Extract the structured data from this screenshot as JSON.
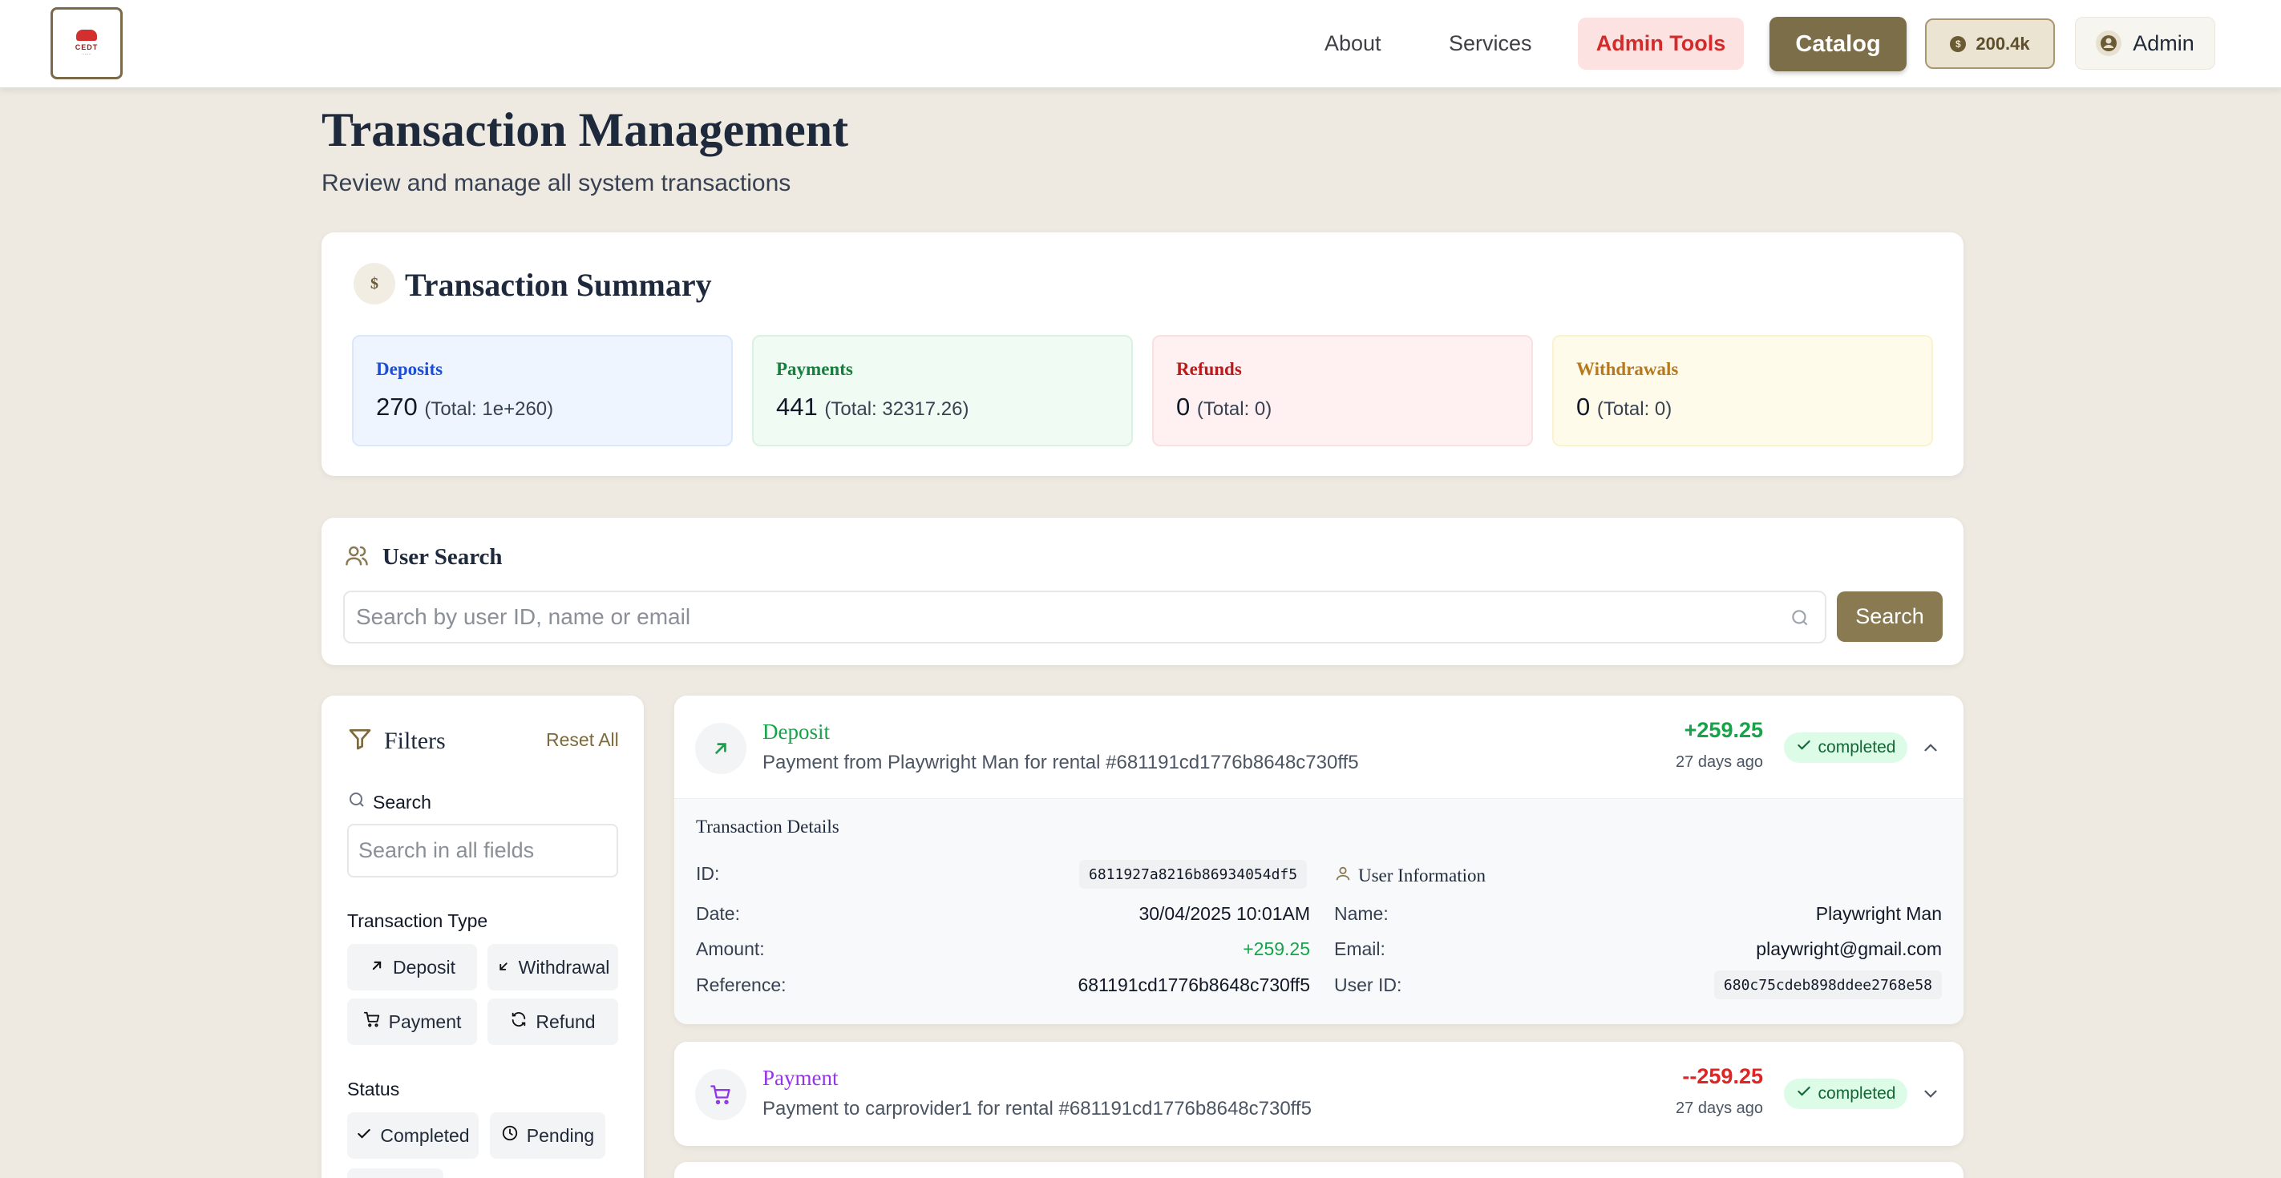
{
  "nav": {
    "logo_text": "CEDT",
    "about": "About",
    "services": "Services",
    "admin_tools": "Admin Tools",
    "catalog": "Catalog",
    "balance": "200.4k",
    "admin": "Admin"
  },
  "header": {
    "title": "Transaction Management",
    "subtitle": "Review and manage all system transactions"
  },
  "summary": {
    "icon": "$",
    "title": "Transaction Summary",
    "stats": [
      {
        "label": "Deposits",
        "count": "270",
        "total": "(Total: 1e+260)",
        "color": "#1d4ed8",
        "bg": "#eef5ff",
        "border": "#dbe7fb"
      },
      {
        "label": "Payments",
        "count": "441",
        "total": "(Total: 32317.26)",
        "color": "#15803d",
        "bg": "#effbf3",
        "border": "#d8f3e1"
      },
      {
        "label": "Refunds",
        "count": "0",
        "total": "(Total: 0)",
        "color": "#b91c1c",
        "bg": "#fff1f1",
        "border": "#fbe0e0"
      },
      {
        "label": "Withdrawals",
        "count": "0",
        "total": "(Total: 0)",
        "color": "#b7791f",
        "bg": "#fffbeb",
        "border": "#fbf2cf"
      }
    ]
  },
  "user_search": {
    "title": "User Search",
    "placeholder": "Search by user ID, name or email",
    "button": "Search"
  },
  "filters": {
    "title": "Filters",
    "reset": "Reset All",
    "search_label": "Search",
    "search_placeholder": "Search in all fields",
    "type_label": "Transaction Type",
    "types": [
      "Deposit",
      "Withdrawal",
      "Payment",
      "Refund"
    ],
    "status_label": "Status",
    "statuses": [
      "Completed",
      "Pending"
    ]
  },
  "transactions": [
    {
      "type": "Deposit",
      "type_color": "#16a34a",
      "description": "Payment from Playwright Man for rental #681191cd1776b8648c730ff5",
      "amount": "+259.25",
      "amount_color": "#16a34a",
      "ago": "27 days ago",
      "status": "completed",
      "details": {
        "title": "Transaction Details",
        "id_label": "ID:",
        "id": "6811927a8216b86934054df5",
        "date_label": "Date:",
        "date": "30/04/2025 10:01AM",
        "amount_label": "Amount:",
        "amount": "+259.25",
        "reference_label": "Reference:",
        "reference": "681191cd1776b8648c730ff5",
        "user_title": "User Information",
        "name_label": "Name:",
        "name": "Playwright Man",
        "email_label": "Email:",
        "email": "playwright@gmail.com",
        "user_id_label": "User ID:",
        "user_id": "680c75cdeb898ddee2768e58"
      }
    },
    {
      "type": "Payment",
      "type_color": "#9333ea",
      "description": "Payment to carprovider1 for rental #681191cd1776b8648c730ff5",
      "amount": "--259.25",
      "amount_color": "#dc2626",
      "ago": "27 days ago",
      "status": "completed"
    }
  ]
}
